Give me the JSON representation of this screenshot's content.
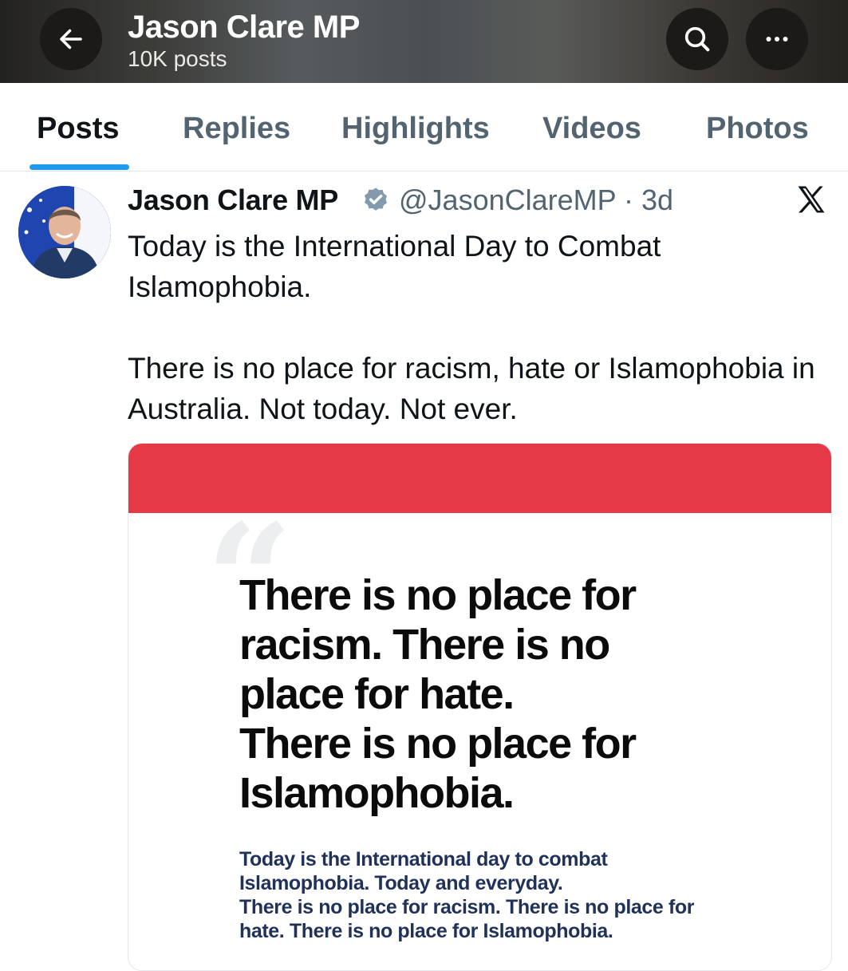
{
  "header": {
    "title": "Jason Clare MP",
    "post_count": "10K posts",
    "back_icon": "arrow-left-icon",
    "search_icon": "search-icon",
    "more_icon": "more-horizontal-icon"
  },
  "tabs": [
    {
      "label": "Posts",
      "active": true
    },
    {
      "label": "Replies",
      "active": false
    },
    {
      "label": "Highlights",
      "active": false
    },
    {
      "label": "Videos",
      "active": false
    },
    {
      "label": "Photos",
      "active": false
    }
  ],
  "post": {
    "author": "Jason Clare MP",
    "handle_time": "@JasonClareMP · 3d",
    "paragraph1": "Today is the International Day to Combat Islamophobia.",
    "paragraph2": "There is no place for racism, hate or Islamophobia in Australia. Not today. Not ever.",
    "verified_icon": "verified-badge-icon",
    "platform_icon": "x-logo-icon"
  },
  "media": {
    "headline_lines": [
      "There is no place for",
      "racism. There is no",
      "place for hate.",
      "There is no place for",
      "Islamophobia."
    ],
    "sub_lines": [
      "Today is the International day to combat",
      "Islamophobia. Today and everyday.",
      "There is no place for racism. There is no place for",
      "hate. There is no place for Islamophobia."
    ]
  },
  "colors": {
    "accent": "#1d9bf0",
    "card_band": "#e63946",
    "sub_text": "#20315a"
  }
}
